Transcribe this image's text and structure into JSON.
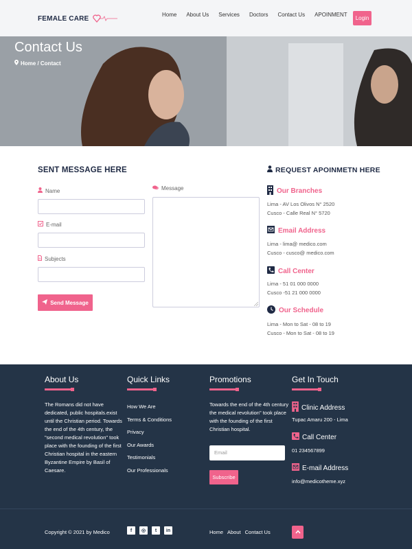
{
  "header": {
    "logo": "FEMALE CARE",
    "nav": [
      "Home",
      "About Us",
      "Services",
      "Doctors",
      "Contact Us",
      "APOINMENT"
    ],
    "login_label": "Login"
  },
  "hero": {
    "title": "Contact Us",
    "breadcrumb": "Home / Contact"
  },
  "form": {
    "title": "SENT MESSAGE HERE",
    "name_label": "Name",
    "email_label": "E-mail",
    "subjects_label": "Subjects",
    "message_label": "Message",
    "send_label": "Send Message"
  },
  "info": {
    "title": "REQUEST APOINMETN HERE",
    "branches": {
      "heading": "Our Branches",
      "lines": [
        "Lima - AV Los Olivos N° 2520",
        "Cusco - Calle Real N° 5720"
      ]
    },
    "email": {
      "heading": "Email Address",
      "lines": [
        "Lima - lima@ medico.com",
        "Cusco - cusco@ medico.com"
      ]
    },
    "call": {
      "heading": "Call Center",
      "lines": [
        "Lima - 51 01 000 0000",
        "Cusco -51 21 000 0000"
      ]
    },
    "schedule": {
      "heading": "Our Schedule",
      "lines": [
        "Lima - Mon to Sat - 08 to 19",
        "Cusco - Mon to Sat - 08 to 19"
      ]
    }
  },
  "footer": {
    "about": {
      "title": "About Us",
      "lines": [
        "The Romans did not have",
        "dedicated, public hospitals.exist",
        "until the Christian period. Towards",
        "the end of the 4th century, the",
        "\"second medical revolution\" took",
        "place with the founding of the first",
        "Christian hospital in the eastern",
        "Byzantine Empire by Basil of",
        "Caesare."
      ]
    },
    "quick": {
      "title": "Quick Links",
      "links": [
        "How We Are",
        "Terms & Conditions",
        "Privacy",
        "Our Awards",
        "Testimonials",
        "Our Professionals"
      ]
    },
    "promotions": {
      "title": "Promotions",
      "lines": [
        "Towards the end of the 4th century",
        "the medical revolution\" took place",
        "with the founding of the first",
        "Christian hospital."
      ],
      "email_placeholder": "Email",
      "subscribe_label": "Subscribe"
    },
    "touch": {
      "title": "Get In Touch",
      "clinic_heading": "Clinic Address",
      "clinic_value": "Tupac Amaru 200 - Lima",
      "call_heading": "Call Center",
      "call_value": "01 234567899",
      "email_heading": "E-mail Address",
      "email_value": "info@medicotheme.xyz"
    },
    "copyright": "Copyright © 2021 by Medico",
    "bottom_nav": [
      "Home",
      "About",
      "Contact Us"
    ]
  },
  "colors": {
    "accent": "#f0638c",
    "navy": "#1f2a44",
    "footer_bg": "#243447"
  }
}
